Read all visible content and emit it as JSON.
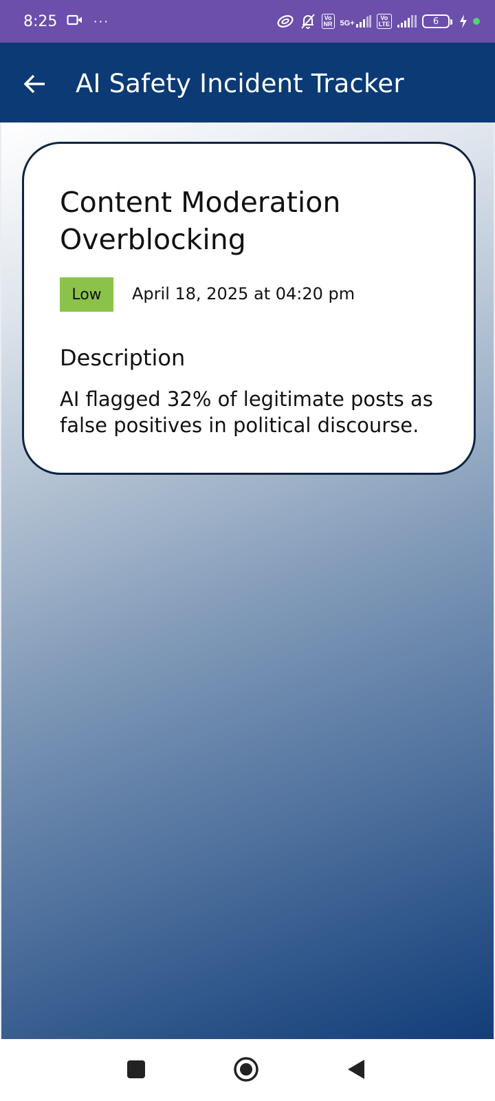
{
  "status_bar": {
    "time": "8:25",
    "more": "···",
    "network": "5G+",
    "vo_nr": "Vo\nNR",
    "vo_lte": "Vo\nLTE",
    "battery_level": "6"
  },
  "app_bar": {
    "title": "AI Safety Incident Tracker"
  },
  "incident": {
    "title": "Content Moderation Overblocking",
    "severity": "Low",
    "severity_color": "#8bc34a",
    "reported_at": "April 18, 2025 at 04:20 pm",
    "description_heading": "Description",
    "description": "AI flagged 32% of legitimate posts as false positives in political discourse."
  },
  "colors": {
    "status_bar": "#6b4fab",
    "app_bar": "#0b3a74",
    "card_border": "#0d2440"
  }
}
